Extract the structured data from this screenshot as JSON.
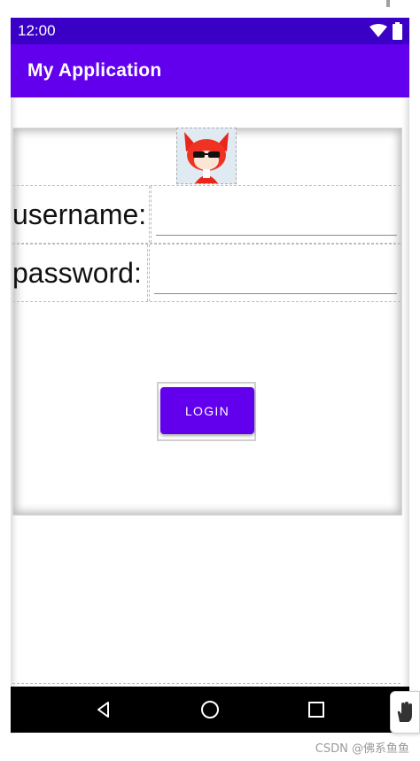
{
  "status_bar": {
    "time": "12:00",
    "icons": [
      "wifi-icon",
      "battery-icon"
    ]
  },
  "app_bar": {
    "title": "My Application"
  },
  "avatar": {
    "icon": "fox-avatar-icon"
  },
  "form": {
    "username_label": "username:",
    "username_value": "",
    "password_label": "password:",
    "password_value": ""
  },
  "login_button": {
    "label": "LOGIN"
  },
  "nav_bar": {
    "icons": [
      "back-icon",
      "home-icon",
      "recents-icon"
    ]
  },
  "floating": {
    "icon": "hand-icon"
  },
  "watermark": {
    "text": "CSDN @佛系鱼鱼"
  },
  "colors": {
    "status_bar": "#3a00c6",
    "app_bar": "#6200ee",
    "button": "#6200ee",
    "nav_bar": "#000000"
  }
}
